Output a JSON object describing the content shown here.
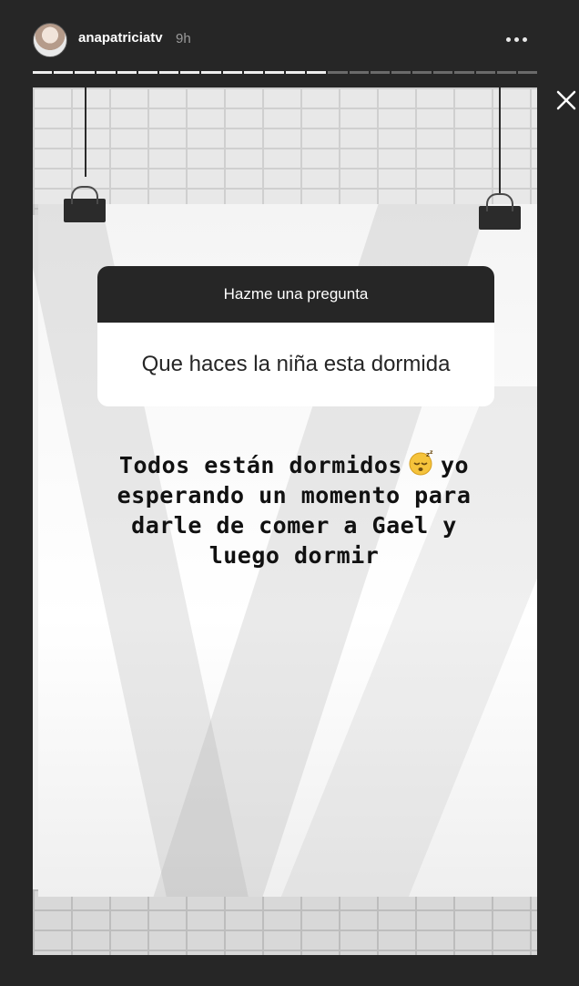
{
  "header": {
    "username": "anapatriciatv",
    "timestamp": "9h",
    "more_icon": "more-horizontal-icon",
    "close_icon": "close-icon"
  },
  "progress": {
    "segments_total": 24,
    "segments_viewed": 14
  },
  "story": {
    "question_sticker": {
      "title": "Hazme una pregunta",
      "question": "Que haces la niña esta dormida"
    },
    "answer": {
      "line1_before_emoji": "Todos están dormidos",
      "emoji": "sleeping-face-emoji",
      "line1_after_emoji": "yo",
      "rest": "esperando un momento para\ndarle de comer a Gael y\nluego dormir"
    }
  },
  "colors": {
    "background": "#262626",
    "story_paper": "#ffffff",
    "sticker_header": "#262626",
    "progress_done": "#ededed",
    "progress_pending": "#6a6a6a"
  }
}
